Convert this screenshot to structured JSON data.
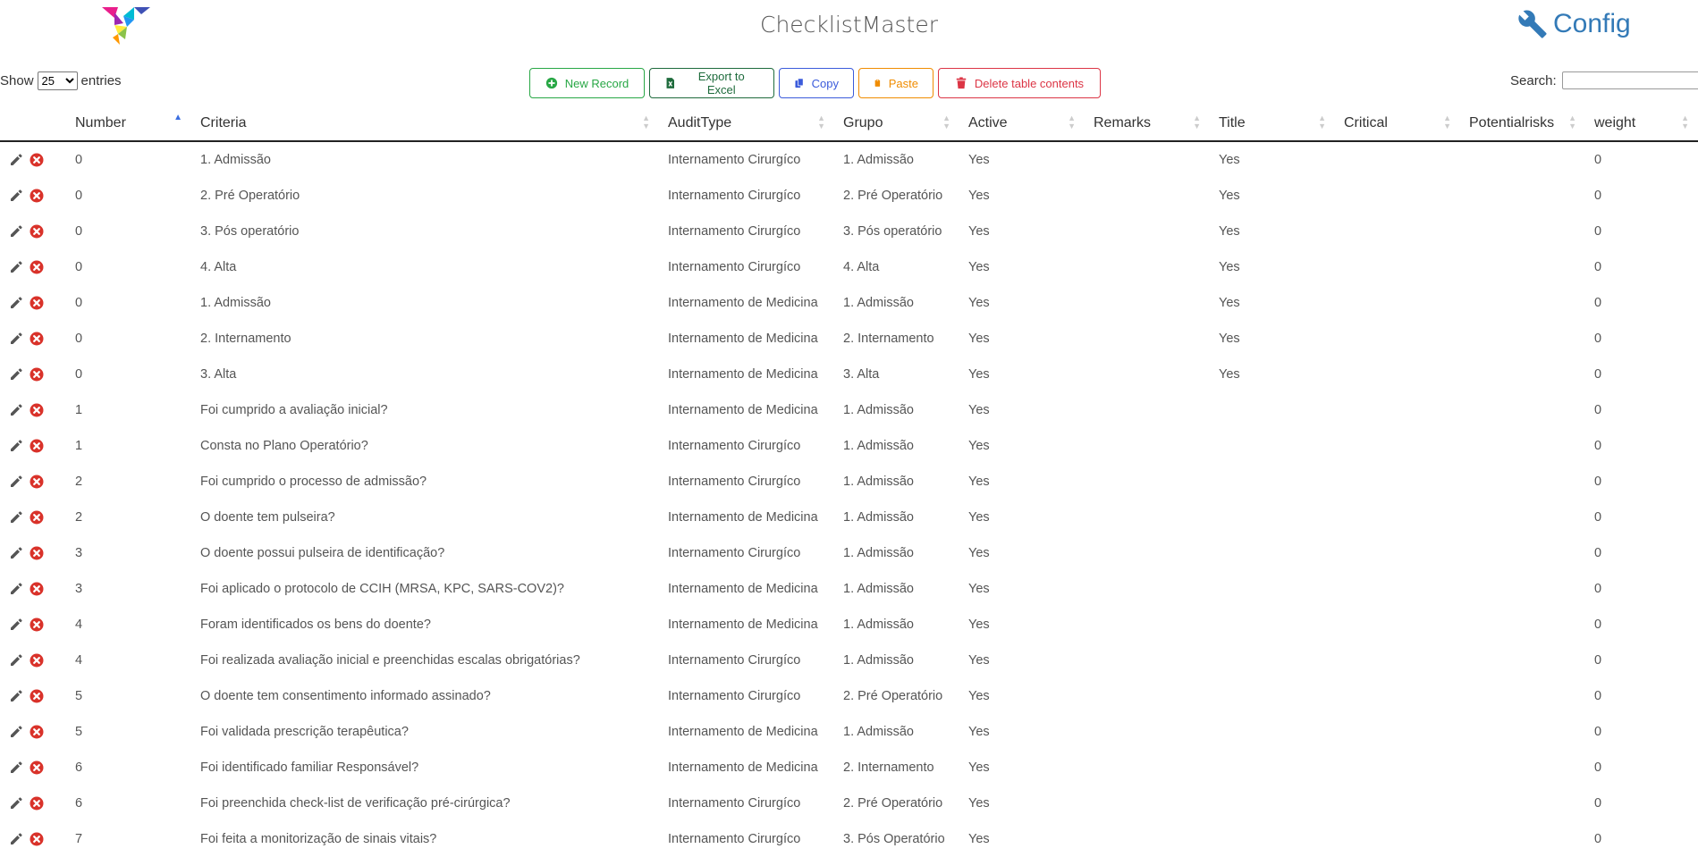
{
  "app": {
    "title": "ChecklistMaster",
    "config_label": "Config"
  },
  "toolbar": {
    "show_label": "Show",
    "entries_label": "entries",
    "page_length": "25",
    "search_label": "Search:",
    "search_value": "",
    "buttons": {
      "new_record": "New Record",
      "export_excel": "Export to Excel",
      "copy": "Copy",
      "paste": "Paste",
      "delete_contents": "Delete table contents"
    }
  },
  "table": {
    "columns": [
      "Number",
      "Criteria",
      "AuditType",
      "Grupo",
      "Active",
      "Remarks",
      "Title",
      "Critical",
      "Potentialrisks",
      "weight"
    ],
    "rows": [
      [
        "0",
        "1. Admissão",
        "Internamento Cirurgíco",
        "1. Admissão",
        "Yes",
        "",
        "Yes",
        "",
        "",
        "0"
      ],
      [
        "0",
        "2. Pré Operatório",
        "Internamento Cirurgíco",
        "2. Pré Operatório",
        "Yes",
        "",
        "Yes",
        "",
        "",
        "0"
      ],
      [
        "0",
        "3. Pós operatório",
        "Internamento Cirurgíco",
        "3. Pós operatório",
        "Yes",
        "",
        "Yes",
        "",
        "",
        "0"
      ],
      [
        "0",
        "4. Alta",
        "Internamento Cirurgíco",
        "4. Alta",
        "Yes",
        "",
        "Yes",
        "",
        "",
        "0"
      ],
      [
        "0",
        "1. Admissão",
        "Internamento de Medicina",
        "1. Admissão",
        "Yes",
        "",
        "Yes",
        "",
        "",
        "0"
      ],
      [
        "0",
        "2. Internamento",
        "Internamento de Medicina",
        "2. Internamento",
        "Yes",
        "",
        "Yes",
        "",
        "",
        "0"
      ],
      [
        "0",
        "3. Alta",
        "Internamento de Medicina",
        "3. Alta",
        "Yes",
        "",
        "Yes",
        "",
        "",
        "0"
      ],
      [
        "1",
        "Foi cumprido a avaliação inicial?",
        "Internamento de Medicina",
        "1. Admissão",
        "Yes",
        "",
        "",
        "",
        "",
        "0"
      ],
      [
        "1",
        "Consta no Plano Operatório?",
        "Internamento Cirurgíco",
        "1. Admissão",
        "Yes",
        "",
        "",
        "",
        "",
        "0"
      ],
      [
        "2",
        "Foi cumprido o processo de admissão?",
        "Internamento Cirurgíco",
        "1. Admissão",
        "Yes",
        "",
        "",
        "",
        "",
        "0"
      ],
      [
        "2",
        "O doente tem pulseira?",
        "Internamento de Medicina",
        "1. Admissão",
        "Yes",
        "",
        "",
        "",
        "",
        "0"
      ],
      [
        "3",
        "O doente possui pulseira de identificação?",
        "Internamento Cirurgíco",
        "1. Admissão",
        "Yes",
        "",
        "",
        "",
        "",
        "0"
      ],
      [
        "3",
        "Foi aplicado o protocolo de CCIH (MRSA, KPC, SARS-COV2)?",
        "Internamento de Medicina",
        "1. Admissão",
        "Yes",
        "",
        "",
        "",
        "",
        "0"
      ],
      [
        "4",
        "Foram identificados os bens do doente?",
        "Internamento de Medicina",
        "1. Admissão",
        "Yes",
        "",
        "",
        "",
        "",
        "0"
      ],
      [
        "4",
        "Foi realizada avaliação inicial e preenchidas escalas obrigatórias?",
        "Internamento Cirurgíco",
        "1. Admissão",
        "Yes",
        "",
        "",
        "",
        "",
        "0"
      ],
      [
        "5",
        "O doente tem consentimento informado assinado?",
        "Internamento Cirurgíco",
        "2. Pré Operatório",
        "Yes",
        "",
        "",
        "",
        "",
        "0"
      ],
      [
        "5",
        "Foi validada prescrição terapêutica?",
        "Internamento de Medicina",
        "1. Admissão",
        "Yes",
        "",
        "",
        "",
        "",
        "0"
      ],
      [
        "6",
        "Foi identificado familiar Responsável?",
        "Internamento de Medicina",
        "2. Internamento",
        "Yes",
        "",
        "",
        "",
        "",
        "0"
      ],
      [
        "6",
        "Foi preenchida check-list de verificação pré-cirúrgica?",
        "Internamento Cirurgíco",
        "2. Pré Operatório",
        "Yes",
        "",
        "",
        "",
        "",
        "0"
      ],
      [
        "7",
        "Foi feita a monitorização de sinais vitais?",
        "Internamento Cirurgíco",
        "3. Pós Operatório",
        "Yes",
        "",
        "",
        "",
        "",
        "0"
      ]
    ]
  },
  "colors": {
    "accent": "#337ab7",
    "edit_icon": "#555555",
    "delete_icon": "#d9322a",
    "sort_active": "#3b6ee0"
  }
}
